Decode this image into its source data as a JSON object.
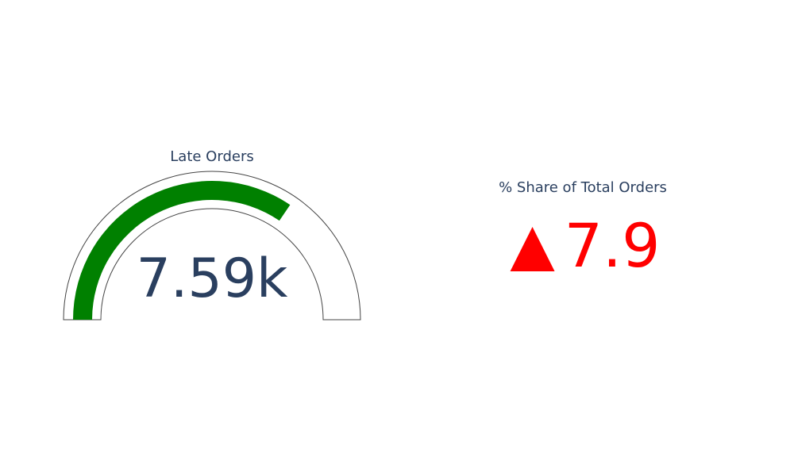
{
  "chart_data": [
    {
      "type": "gauge",
      "title": "Late Orders",
      "value": 7590,
      "display_value": "7.59k",
      "range": [
        0,
        11000
      ],
      "bar_color": "#008000",
      "border_color": "#444444"
    },
    {
      "type": "delta-indicator",
      "title": "% Share of Total Orders",
      "delta": 7.9,
      "display_value": "7.9",
      "direction": "increasing",
      "color": "#ff0000"
    }
  ]
}
